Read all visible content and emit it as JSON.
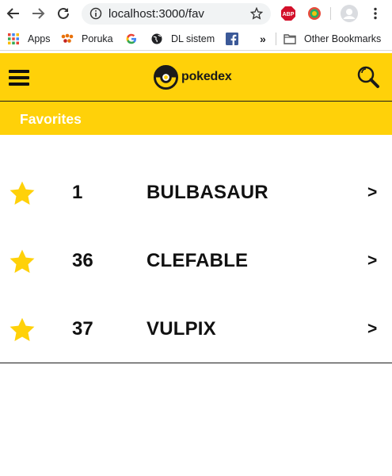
{
  "browser": {
    "url": "localhost:3000/fav",
    "bookmarks": [
      {
        "label": "Apps",
        "icon": "apps-grid-icon"
      },
      {
        "label": "Poruka",
        "icon": "poruka-icon"
      },
      {
        "label": "",
        "icon": "google-icon"
      },
      {
        "label": "DL sistem",
        "icon": "globe-icon"
      },
      {
        "label": "",
        "icon": "facebook-icon"
      }
    ],
    "more_bookmarks": "»",
    "other_bookmarks": "Other Bookmarks",
    "extensions": [
      "ABP"
    ]
  },
  "header": {
    "logo_text": "pokedex",
    "menu_icon": "hamburger-icon",
    "search_icon": "search-icon",
    "accent": "#ffd109"
  },
  "subheader": {
    "title": "Favorites"
  },
  "favorites": [
    {
      "number": "1",
      "name": "BULBASAUR",
      "arrow": ">"
    },
    {
      "number": "36",
      "name": "CLEFABLE",
      "arrow": ">"
    },
    {
      "number": "37",
      "name": "VULPIX",
      "arrow": ">"
    }
  ],
  "colors": {
    "accent": "#ffd109",
    "star": "#ffd109",
    "text": "#111111"
  }
}
